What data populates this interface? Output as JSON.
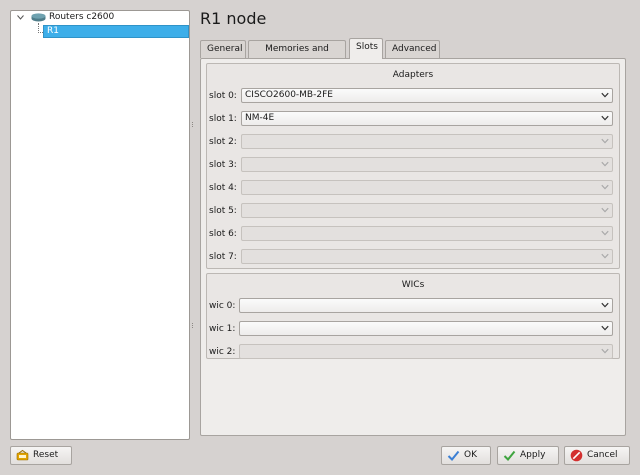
{
  "tree": {
    "root_label": "Routers c2600",
    "selected_label": "R1"
  },
  "page_title": "R1 node",
  "tabs": [
    {
      "label": "General"
    },
    {
      "label": "Memories and disks"
    },
    {
      "label": "Slots"
    },
    {
      "label": "Advanced"
    }
  ],
  "active_tab": "Slots",
  "adapters": {
    "title": "Adapters",
    "slots": [
      {
        "label": "slot 0:",
        "value": "CISCO2600-MB-2FE",
        "enabled": true
      },
      {
        "label": "slot 1:",
        "value": "NM-4E",
        "enabled": true
      },
      {
        "label": "slot 2:",
        "value": "",
        "enabled": false
      },
      {
        "label": "slot 3:",
        "value": "",
        "enabled": false
      },
      {
        "label": "slot 4:",
        "value": "",
        "enabled": false
      },
      {
        "label": "slot 5:",
        "value": "",
        "enabled": false
      },
      {
        "label": "slot 6:",
        "value": "",
        "enabled": false
      },
      {
        "label": "slot 7:",
        "value": "",
        "enabled": false
      }
    ]
  },
  "wics": {
    "title": "WICs",
    "slots": [
      {
        "label": "wic 0:",
        "value": "",
        "enabled": true
      },
      {
        "label": "wic 1:",
        "value": "",
        "enabled": true
      },
      {
        "label": "wic 2:",
        "value": "",
        "enabled": false
      }
    ]
  },
  "buttons": {
    "reset": "Reset",
    "ok": "OK",
    "apply": "Apply",
    "cancel": "Cancel"
  },
  "colors": {
    "selection": "#3daee9",
    "check_ok": "#3b7fd4",
    "check_apply": "#3fa43f",
    "cancel": "#d32f2f"
  }
}
